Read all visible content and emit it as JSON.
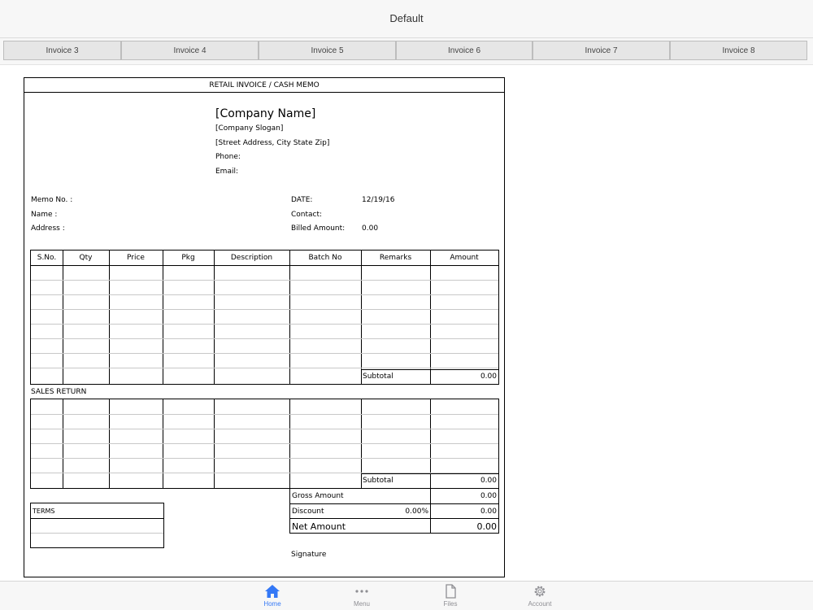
{
  "window": {
    "title": "Default"
  },
  "tabs": [
    "Invoice 3",
    "Invoice 4",
    "Invoice 5",
    "Invoice 6",
    "Invoice 7",
    "Invoice 8"
  ],
  "invoice": {
    "heading": "RETAIL INVOICE / CASH MEMO",
    "company_name": "[Company Name]",
    "company_slogan": "[Company Slogan]",
    "street_address": "[Street Address, City State Zip]",
    "phone_label": "Phone:",
    "email_label": "Email:",
    "memo_no_label": "Memo No. :",
    "name_label": "Name :",
    "address_label": "Address :",
    "date_label": "DATE:",
    "date_value": "12/19/16",
    "contact_label": "Contact:",
    "billed_amount_label": "Billed Amount:",
    "billed_amount_value": "0.00",
    "columns": [
      "S.No.",
      "Qty",
      "Price",
      "Pkg",
      "Description",
      "Batch No",
      "Remarks",
      "Amount"
    ],
    "subtotal_label": "Subtotal",
    "subtotal_value": "0.00",
    "sales_return_label": "SALES RETURN",
    "return_subtotal_label": "Subtotal",
    "return_subtotal_value": "0.00",
    "gross_amount_label": "Gross Amount",
    "gross_amount_value": "0.00",
    "discount_label": "Discount",
    "discount_percent": "0.00%",
    "discount_value": "0.00",
    "net_amount_label": "Net Amount",
    "net_amount_value": "0.00",
    "terms_label": "TERMS",
    "signature_label": "Signature"
  },
  "bottom_nav": {
    "home": "Home",
    "menu": "Menu",
    "files": "Files",
    "account": "Account"
  },
  "colors": {
    "accent": "#3478f6",
    "inactive": "#8e8e93"
  }
}
